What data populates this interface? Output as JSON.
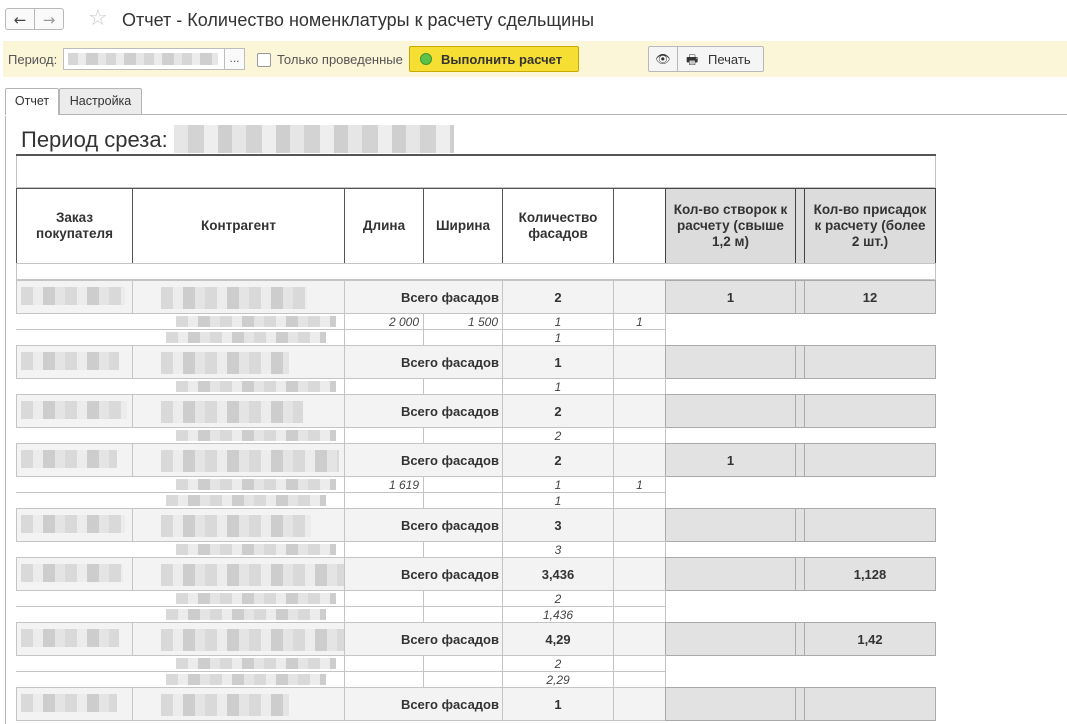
{
  "window": {
    "back_glyph": "←",
    "forward_glyph": "→",
    "favorite_glyph": "☆",
    "title": "Отчет - Количество номенклатуры к расчету сдельщины"
  },
  "toolbar": {
    "period_label": "Период:",
    "select_glyph": "...",
    "posted_only_label": "Только проведенные",
    "run_label": "Выполнить расчет",
    "eye_glyph": "👁",
    "print_glyph": "🖶",
    "print_label": "Печать",
    "accent_color": "#f6de33",
    "panel_color": "#fbf6d8"
  },
  "tabs": [
    {
      "label": "Отчет",
      "active": true
    },
    {
      "label": "Настройка",
      "active": false
    }
  ],
  "report": {
    "period_title": "Период среза:",
    "headers": {
      "order": "Заказ покупателя",
      "counterparty": "Контрагент",
      "length": "Длина",
      "width": "Ширина",
      "facades": "Количество фасадов",
      "sashes": "Кол-во створок к расчету (свыше 1,2 м)",
      "inserts": "Кол-во присадок к расчету (более 2 шт.)"
    },
    "groups": [
      {
        "label": "Всего фасадов",
        "total": "2",
        "sashes": "1",
        "inserts": "12",
        "details": [
          {
            "length": "2 000",
            "width": "1 500",
            "qty": "1",
            "extra": "1"
          },
          {
            "length": "",
            "width": "",
            "qty": "1",
            "extra": ""
          }
        ]
      },
      {
        "label": "Всего фасадов",
        "total": "1",
        "sashes": "",
        "inserts": "",
        "details": [
          {
            "length": "",
            "width": "",
            "qty": "1",
            "extra": ""
          }
        ]
      },
      {
        "label": "Всего фасадов",
        "total": "2",
        "sashes": "",
        "inserts": "",
        "details": [
          {
            "length": "",
            "width": "",
            "qty": "2",
            "extra": ""
          }
        ]
      },
      {
        "label": "Всего фасадов",
        "total": "2",
        "sashes": "1",
        "inserts": "",
        "details": [
          {
            "length": "1 619",
            "width": "",
            "qty": "1",
            "extra": "1"
          },
          {
            "length": "",
            "width": "",
            "qty": "1",
            "extra": ""
          }
        ]
      },
      {
        "label": "Всего фасадов",
        "total": "3",
        "sashes": "",
        "inserts": "",
        "details": [
          {
            "length": "",
            "width": "",
            "qty": "3",
            "extra": ""
          }
        ]
      },
      {
        "label": "Всего фасадов",
        "total": "3,436",
        "sashes": "",
        "inserts": "1,128",
        "details": [
          {
            "length": "",
            "width": "",
            "qty": "2",
            "extra": ""
          },
          {
            "length": "",
            "width": "",
            "qty": "1,436",
            "extra": ""
          }
        ]
      },
      {
        "label": "Всего фасадов",
        "total": "4,29",
        "sashes": "",
        "inserts": "1,42",
        "details": [
          {
            "length": "",
            "width": "",
            "qty": "2",
            "extra": ""
          },
          {
            "length": "",
            "width": "",
            "qty": "2,29",
            "extra": ""
          }
        ]
      },
      {
        "label": "Всего фасадов",
        "total": "1",
        "sashes": "",
        "inserts": "",
        "details": []
      }
    ]
  }
}
